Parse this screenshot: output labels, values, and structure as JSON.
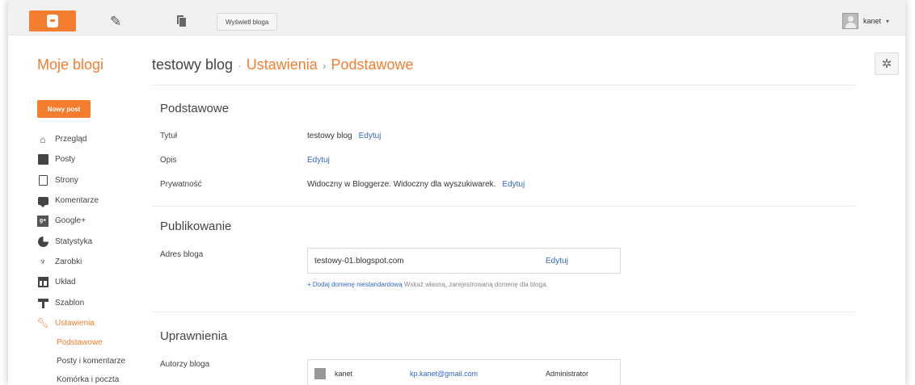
{
  "topbar": {
    "view_blog_label": "Wyświetl bloga",
    "user_name": "kanet",
    "user_caret": "▾"
  },
  "sidebar": {
    "title": "Moje blogi",
    "new_post_label": "Nowy post",
    "items": [
      {
        "label": "Przegląd",
        "icon": "home-icon"
      },
      {
        "label": "Posty",
        "icon": "posts-icon"
      },
      {
        "label": "Strony",
        "icon": "pages-icon"
      },
      {
        "label": "Komentarze",
        "icon": "comments-icon"
      },
      {
        "label": "Google+",
        "icon": "google-plus-icon"
      },
      {
        "label": "Statystyka",
        "icon": "stats-icon"
      },
      {
        "label": "Zarobki",
        "icon": "trophy-icon"
      },
      {
        "label": "Układ",
        "icon": "layout-icon"
      },
      {
        "label": "Szablon",
        "icon": "template-icon"
      },
      {
        "label": "Ustawienia",
        "icon": "wrench-icon",
        "active": true
      }
    ],
    "subitems": [
      {
        "label": "Podstawowe",
        "active": true
      },
      {
        "label": "Posty i komentarze"
      },
      {
        "label": "Komórka i poczta"
      }
    ]
  },
  "breadcrumb": {
    "blog": "testowy blog",
    "sep1": "·",
    "settings": "Ustawienia",
    "sep2": "›",
    "page": "Podstawowe"
  },
  "sections": {
    "basic": {
      "title": "Podstawowe",
      "title_label": "Tytuł",
      "title_value": "testowy blog",
      "title_edit": "Edytuj",
      "desc_label": "Opis",
      "desc_edit": "Edytuj",
      "privacy_label": "Prywatność",
      "privacy_value": "Widoczny w Bloggerze. Widoczny dla wyszukiwarek.",
      "privacy_edit": "Edytuj"
    },
    "publishing": {
      "title": "Publikowanie",
      "address_label": "Adres bloga",
      "address_value": "testowy-01.blogspot.com",
      "address_edit": "Edytuj",
      "add_domain_link": "+ Dodaj domenę niestandardową",
      "add_domain_note": "Wskaż własną, zarejestrowaną domenę dla bloga."
    },
    "permissions": {
      "title": "Uprawnienia",
      "authors_label": "Autorzy bloga",
      "authors": [
        {
          "name": "kanet",
          "email": "kp.kanet@gmail.com",
          "role": "Administrator"
        }
      ]
    }
  },
  "colors": {
    "accent": "#f57d2f",
    "link": "#3366cc"
  }
}
